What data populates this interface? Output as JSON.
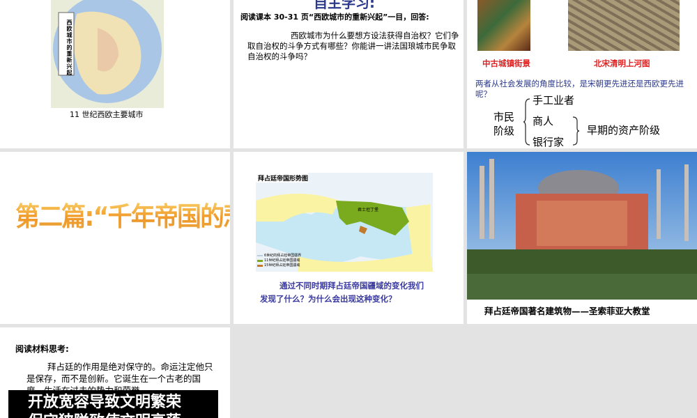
{
  "slides": [
    {
      "caption": "11 世纪西欧主要城市",
      "map_label": "西欧城市的重新兴起"
    },
    {
      "title": "自主学习:",
      "intro": "阅读课本 30-31 页“西欧城市的重新兴起”一目，回答:",
      "body": "西欧城市为什么要想方设法获得自治权？它们争取自治权的斗争方式有哪些？你能讲一讲法国琅城市民争取自治权的斗争吗？"
    },
    {
      "img1_caption": "中古城镇街景",
      "img2_caption": "北宋清明上河图",
      "question": "两者从社会发展的角度比较，是宋朝更先进还是西欧更先进呢？",
      "class_label_1": "市民",
      "class_label_2": "阶级",
      "items": [
        "手工业者",
        "商人",
        "银行家"
      ],
      "result": "早期的资产阶级"
    },
    {
      "title": "第二篇:“千年帝国的悲剧”"
    },
    {
      "map_title": "拜占廷帝国形势图",
      "legend": [
        "6世纪的拜占廷帝国疆界",
        "11世纪拜占廷帝国疆域",
        "15世纪拜占廷帝国疆域"
      ],
      "city": "君士坦丁堡",
      "question": "通过不同时期拜占廷帝国疆域的变化我们发现了什么？为什么会出现这种变化？"
    },
    {
      "caption": "拜占廷帝国著名建筑物——圣索菲亚大教堂"
    },
    {
      "heading": "阅读材料思考:",
      "body": "拜占廷的作用是绝对保守的。命运注定他只是保存，而不是创新。它诞生在一个古老的国度，生活在过去的势力和荣誉",
      "banner1": "开放宽容导致文明繁荣",
      "banner2": "保守狭隘致使文明衰落"
    }
  ]
}
